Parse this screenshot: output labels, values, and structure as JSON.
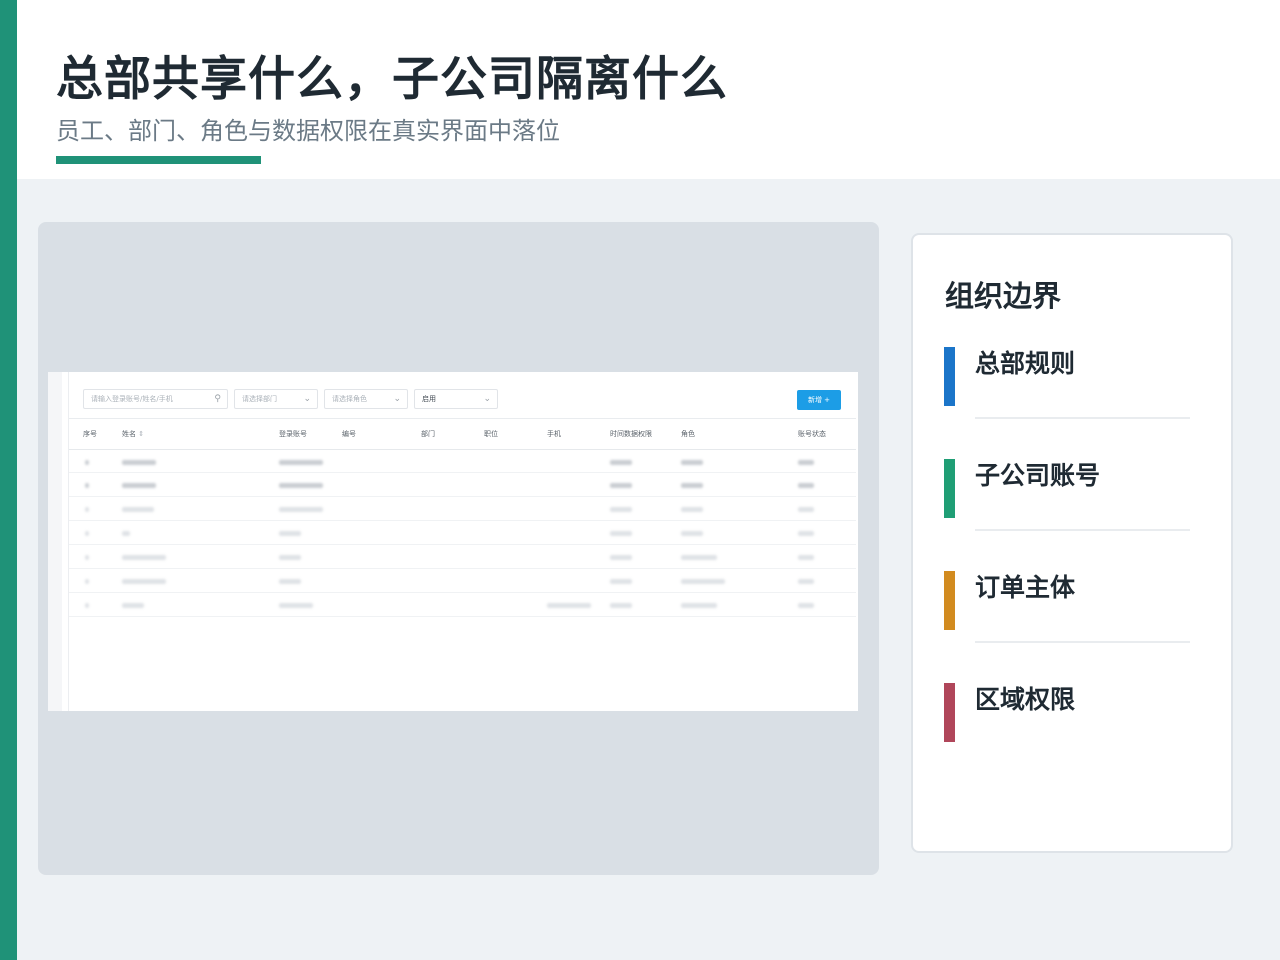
{
  "slide": {
    "title": "总部共享什么，子公司隔离什么",
    "subtitle": "员工、部门、角色与数据权限在真实界面中落位",
    "colors": {
      "accent": "#1f9278",
      "background": "#eef2f5"
    }
  },
  "screenshot": {
    "filters": {
      "search_placeholder": "请输入登录账号/姓名/手机",
      "search_icon": "search-icon",
      "department_placeholder": "请选择部门",
      "role_placeholder": "请选择角色",
      "status_value": "启用",
      "add_button_label": "新增 +"
    },
    "table": {
      "headers": [
        "序号",
        "姓名",
        "登录账号",
        "编号",
        "部门",
        "职位",
        "手机",
        "时间数据权限",
        "角色",
        "账号状态"
      ],
      "sort_icon": "sort-icon",
      "rows": [
        {
          "index": "1"
        },
        {
          "index": "2"
        },
        {
          "index": "3"
        },
        {
          "index": "4"
        },
        {
          "index": "5"
        },
        {
          "index": "6"
        },
        {
          "index": "7"
        }
      ]
    }
  },
  "panel": {
    "title": "组织边界",
    "items": [
      {
        "label": "总部规则",
        "color": "#1b75c9"
      },
      {
        "label": "子公司账号",
        "color": "#1f9e75"
      },
      {
        "label": "订单主体",
        "color": "#d28b1f"
      },
      {
        "label": "区域权限",
        "color": "#b0465a"
      }
    ]
  }
}
